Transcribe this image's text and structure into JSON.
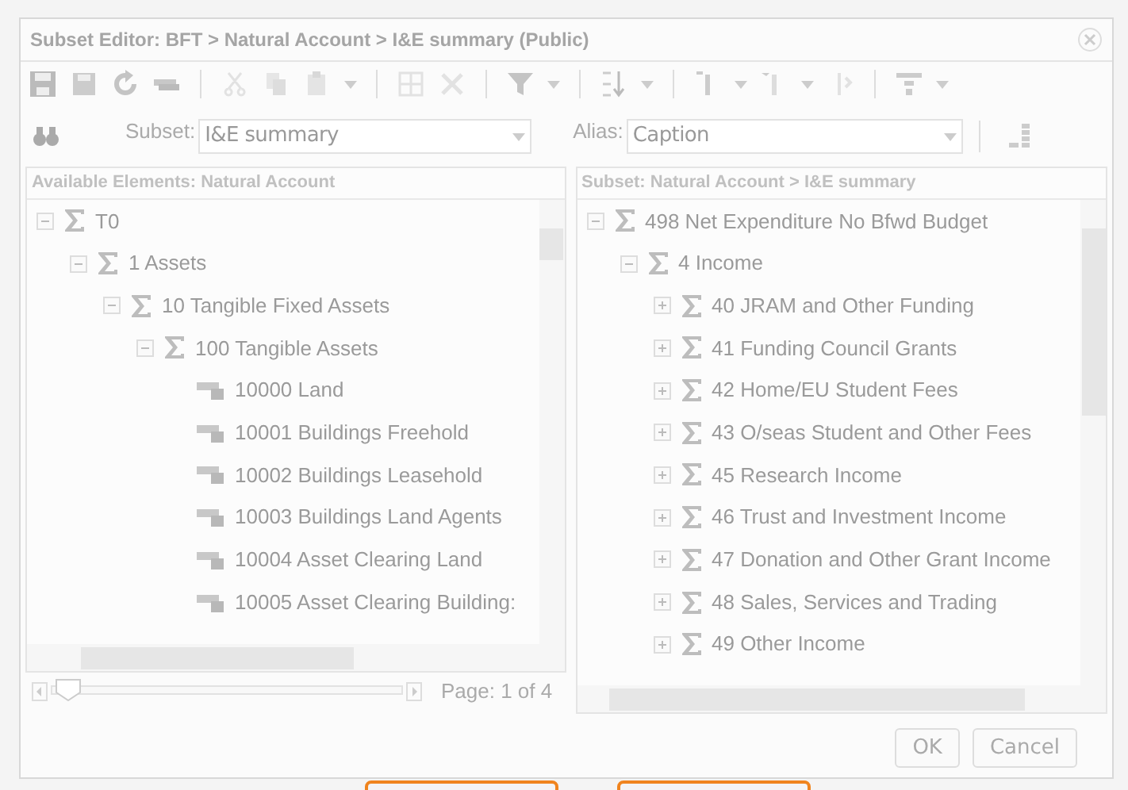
{
  "dialog": {
    "title": "Subset Editor: BFT > Natural Account > I&E summary (Public)",
    "subset": {
      "label": "Subset:",
      "value": "I&E summary"
    },
    "alias": {
      "label": "Alias:",
      "value": "Caption"
    },
    "available": {
      "header": "Available Elements: Natural Account",
      "tree": [
        {
          "label": "T0",
          "kind": "consolidated",
          "expanded": true,
          "children": [
            {
              "label": "1 Assets",
              "kind": "consolidated",
              "expanded": true,
              "children": [
                {
                  "label": "10 Tangible Fixed Assets",
                  "kind": "consolidated",
                  "expanded": true,
                  "children": [
                    {
                      "label": "100 Tangible Assets",
                      "kind": "consolidated",
                      "expanded": true,
                      "children": [
                        {
                          "label": "10000 Land",
                          "kind": "leaf"
                        },
                        {
                          "label": "10001 Buildings Freehold",
                          "kind": "leaf"
                        },
                        {
                          "label": "10002 Buildings Leasehold",
                          "kind": "leaf"
                        },
                        {
                          "label": "10003 Buildings Land Agents",
                          "kind": "leaf"
                        },
                        {
                          "label": "10004 Asset Clearing Land",
                          "kind": "leaf"
                        },
                        {
                          "label": "10005 Asset Clearing Building:",
                          "kind": "leaf"
                        }
                      ]
                    }
                  ]
                }
              ]
            }
          ]
        }
      ],
      "pager": "Page: 1 of 4",
      "page_slider": {
        "level": 0
      }
    },
    "subset_panel": {
      "header": "Subset: Natural Account > I&E summary",
      "tree": [
        {
          "label": "498 Net Expenditure No Bfwd Budget",
          "kind": "consolidated",
          "expanded": true,
          "children": [
            {
              "label": "4 Income",
              "kind": "consolidated",
              "expanded": true,
              "children": [
                {
                  "label": "40 JRAM and Other Funding",
                  "kind": "consolidated",
                  "expanded": false
                },
                {
                  "label": "41 Funding Council Grants",
                  "kind": "consolidated",
                  "expanded": false
                },
                {
                  "label": "42 Home/EU Student Fees",
                  "kind": "consolidated",
                  "expanded": false
                },
                {
                  "label": "43 O/seas Student and Other Fees",
                  "kind": "consolidated",
                  "expanded": false
                },
                {
                  "label": "45 Research Income",
                  "kind": "consolidated",
                  "expanded": false
                },
                {
                  "label": "46 Trust and Investment Income",
                  "kind": "consolidated",
                  "expanded": false
                },
                {
                  "label": "47 Donation and Other Grant Income",
                  "kind": "consolidated",
                  "expanded": false
                },
                {
                  "label": "48 Sales, Services and Trading",
                  "kind": "consolidated",
                  "expanded": false
                },
                {
                  "label": "49 Other Income",
                  "kind": "consolidated",
                  "expanded": false
                }
              ]
            }
          ]
        }
      ]
    },
    "buttons": [
      "OK",
      "Cancel"
    ]
  }
}
